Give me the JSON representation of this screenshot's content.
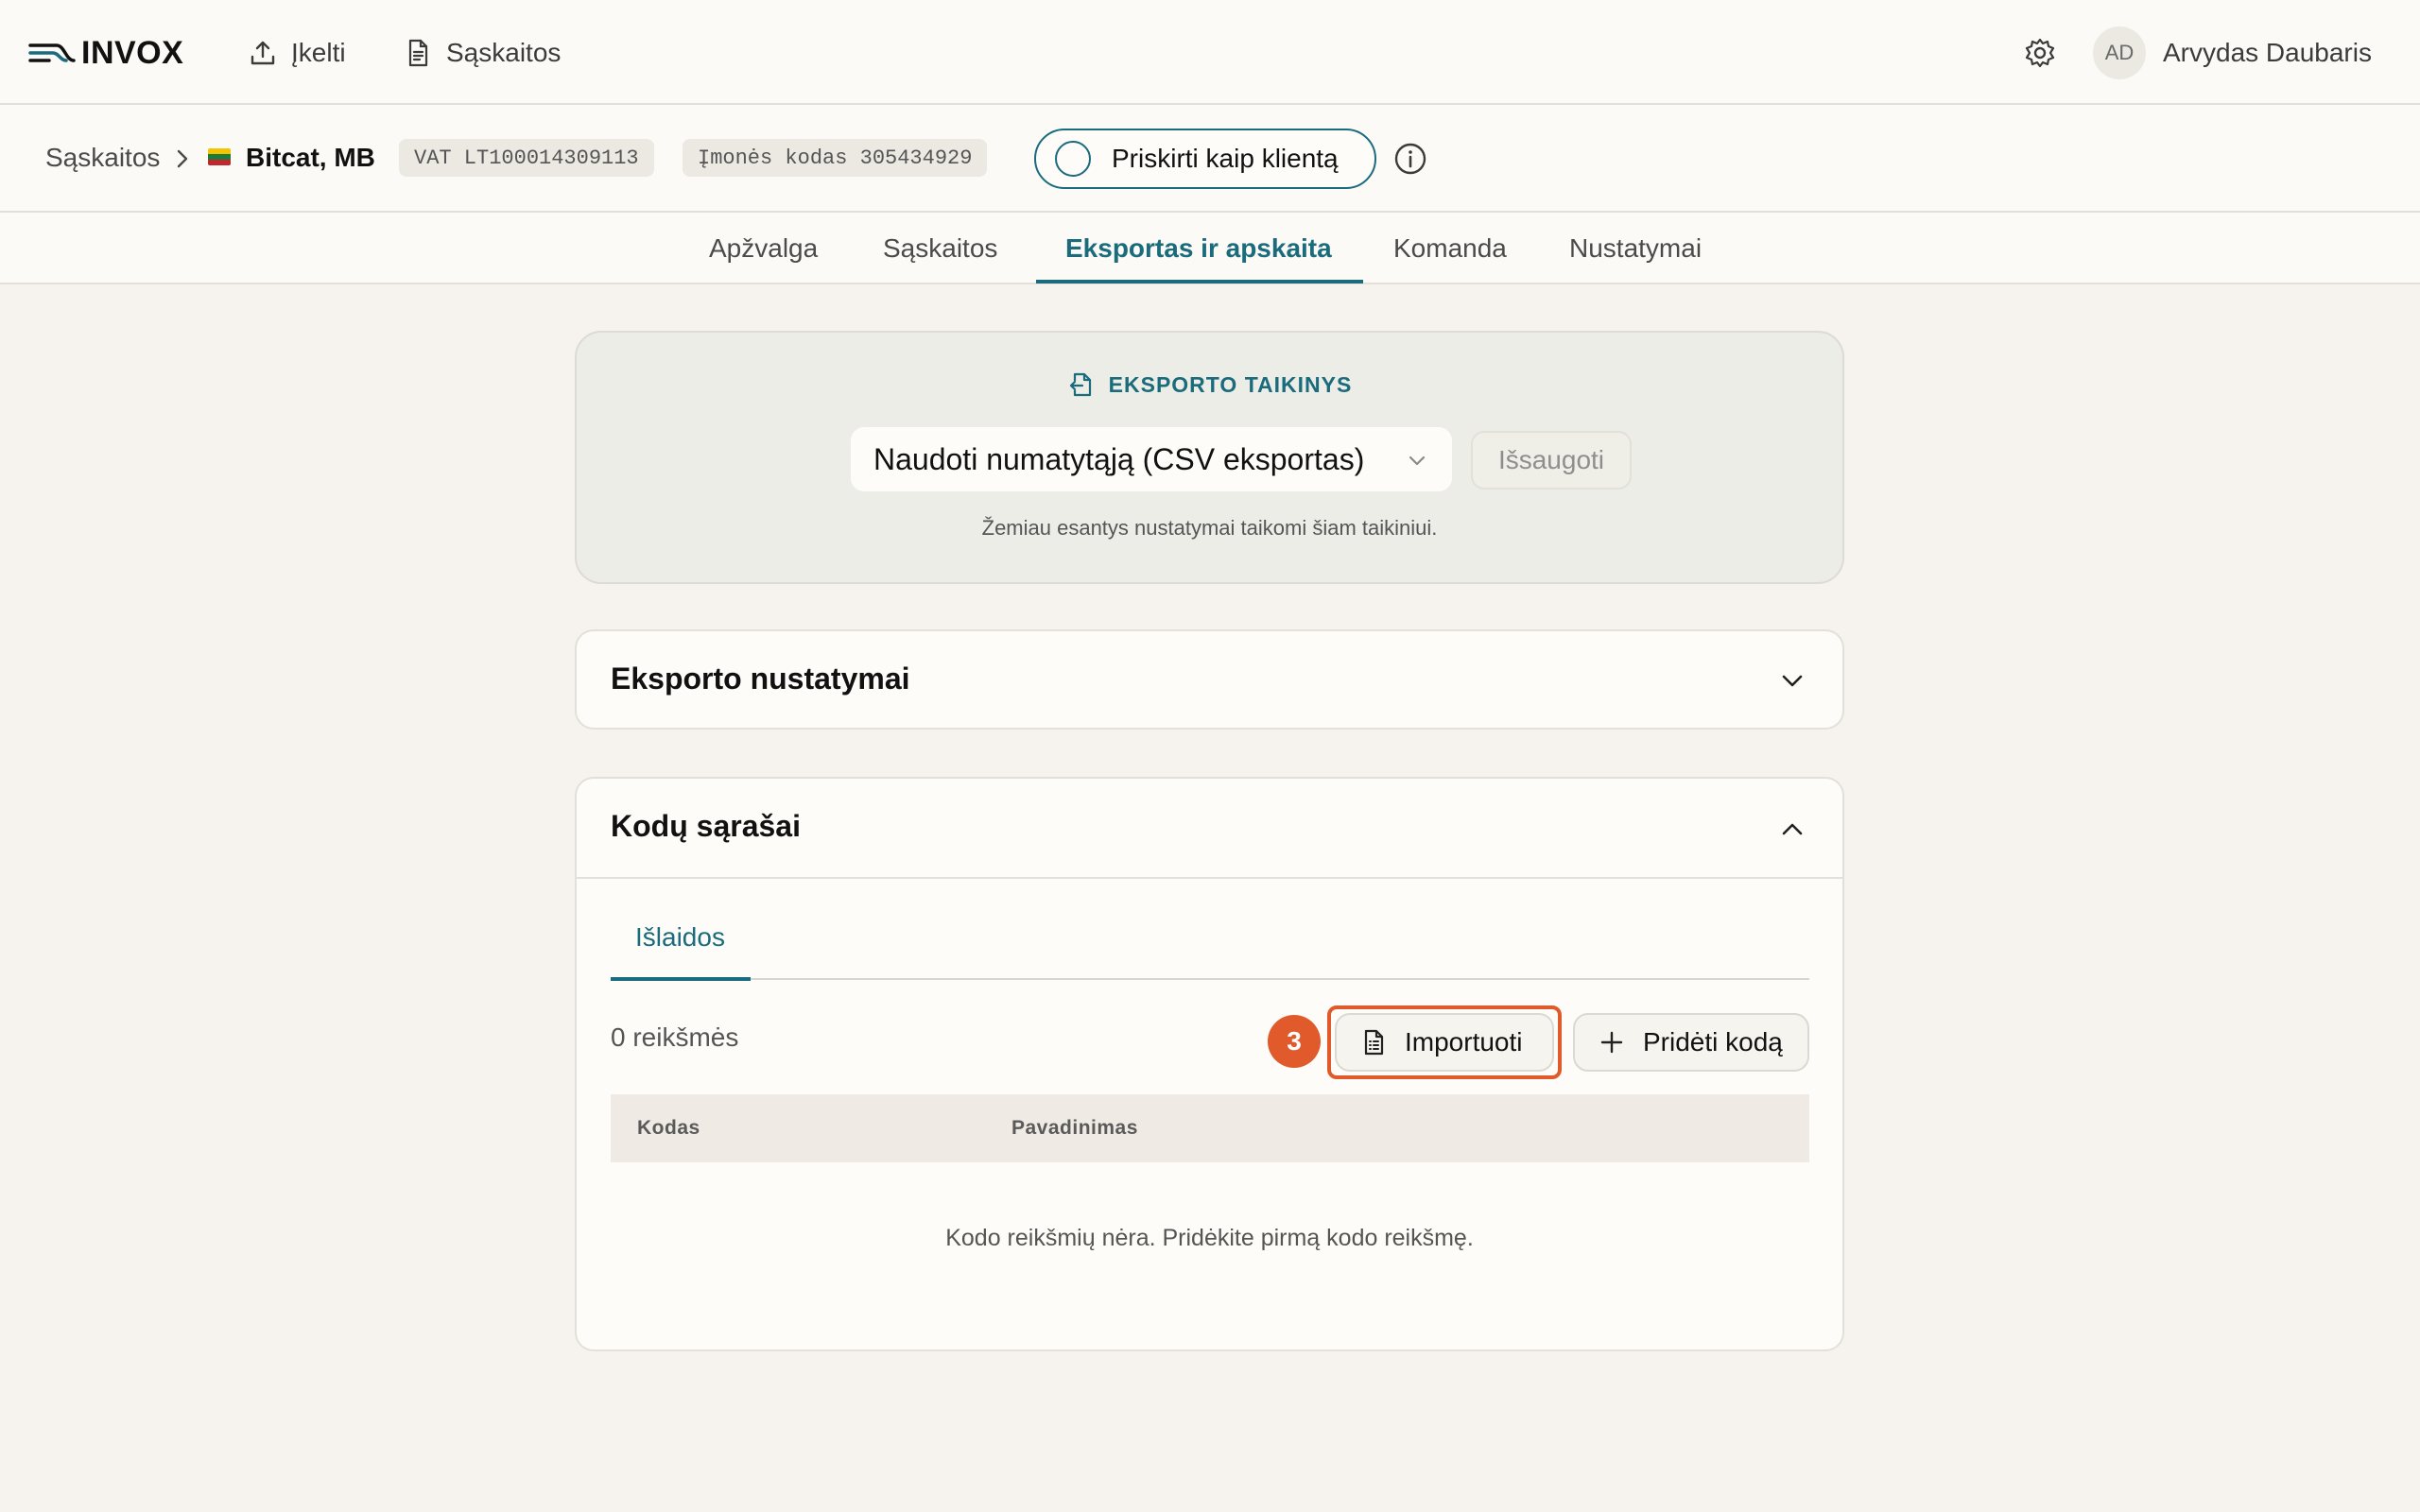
{
  "app": {
    "logo_text": "INVOX",
    "nav": {
      "upload_label": "Įkelti",
      "invoices_label": "Sąskaitos"
    },
    "user": {
      "initials": "AD",
      "name": "Arvydas Daubaris"
    }
  },
  "breadcrumb": {
    "root": "Sąskaitos",
    "company": "Bitcat, MB",
    "vat_chip": "VAT LT100014309113",
    "company_code_chip": "Įmonės kodas 305434929",
    "assign_button": "Priskirti kaip klientą"
  },
  "tabs": [
    {
      "label": "Apžvalga"
    },
    {
      "label": "Sąskaitos"
    },
    {
      "label": "Eksportas ir apskaita",
      "active": true
    },
    {
      "label": "Komanda"
    },
    {
      "label": "Nustatymai"
    }
  ],
  "export_target": {
    "heading": "EKSPORTO TAIKINYS",
    "selected": "Naudoti numatytąją (CSV eksportas)",
    "save_label": "Išsaugoti",
    "note": "Žemiau esantys nustatymai taikomi šiam taikiniui."
  },
  "export_settings": {
    "title": "Eksporto nustatymai"
  },
  "code_lists": {
    "title": "Kodų sąrašai",
    "subtab": "Išlaidos",
    "count": "0 reikšmės",
    "step_badge": "3",
    "import_label": "Importuoti",
    "add_label": "Pridėti kodą",
    "columns": [
      "Kodas",
      "Pavadinimas"
    ],
    "empty_message": "Kodo reikšmių nėra. Pridėkite pirmą kodo reikšmę."
  },
  "colors": {
    "accent": "#1a6b7c",
    "highlight": "#e05a2b",
    "background": "#f6f2ee"
  },
  "flag_colors": [
    "#f5c400",
    "#1e7a3c",
    "#c1272d"
  ]
}
